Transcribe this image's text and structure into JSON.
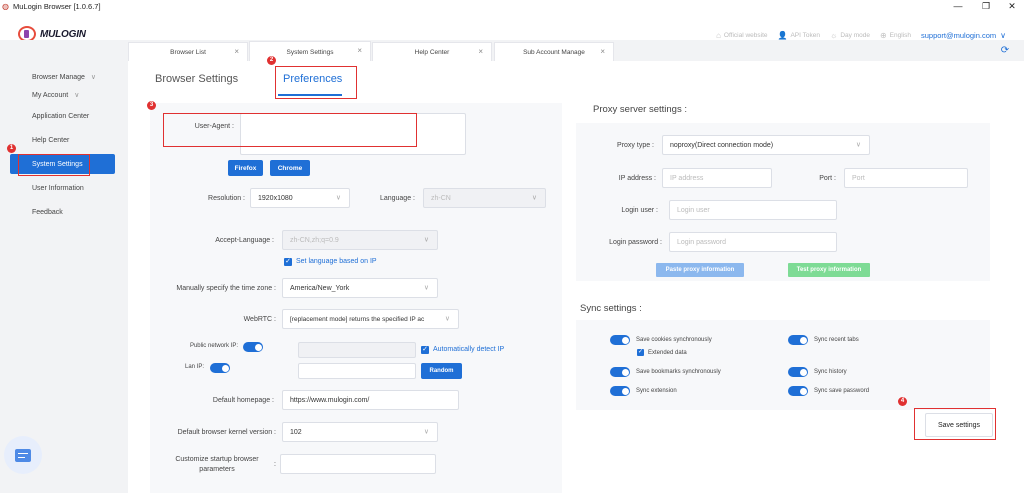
{
  "window": {
    "title": "MuLogin Browser  [1.0.6.7]",
    "minimize": "—",
    "restore": "❐",
    "close": "✕"
  },
  "header": {
    "logo_text": "MULOGIN",
    "links": [
      {
        "label": "Official website",
        "icon": "home-icon"
      },
      {
        "label": "API Token",
        "icon": "user-key-icon"
      },
      {
        "label": "Day mode",
        "icon": "sun-icon"
      },
      {
        "label": "English",
        "icon": "globe-icon"
      }
    ],
    "email": "support@mulogin.com"
  },
  "sidebar": {
    "items": [
      {
        "label": "Browser Manage",
        "has_chevron": true
      },
      {
        "label": "My Account",
        "has_chevron": true
      },
      {
        "label": "Application Center"
      },
      {
        "label": "Help Center"
      },
      {
        "label": "System Settings",
        "active": true
      },
      {
        "label": "User Information"
      },
      {
        "label": "Feedback"
      }
    ]
  },
  "tabs": [
    {
      "label": "Browser List"
    },
    {
      "label": "System Settings",
      "active": true
    },
    {
      "label": "Help Center"
    },
    {
      "label": "Sub Account Manage"
    }
  ],
  "content": {
    "subtabs": {
      "browser_settings": "Browser Settings",
      "preferences": "Preferences"
    },
    "browser": {
      "user_agent_label": "User-Agent :",
      "user_agent_value": "",
      "firefox_btn": "Firefox",
      "chrome_btn": "Chrome",
      "resolution_label": "Resolution :",
      "resolution_value": "1920x1080",
      "language_label": "Language :",
      "language_value": "zh-CN",
      "accept_language_label": "Accept-Language :",
      "accept_language_value": "zh-CN,zh;q=0.9",
      "set_language_label": "Set language based on IP",
      "timezone_label": "Manually specify the time zone :",
      "timezone_value": "America/New_York",
      "webrtc_label": "WebRTC :",
      "webrtc_value": "[replacement mode] returns the specified IP ac",
      "public_ip_label": "Public network IP:",
      "public_ip_value": "",
      "auto_detect_label": "Automatically detect IP",
      "lan_ip_label": "Lan IP:",
      "lan_ip_value": "",
      "random_btn": "Random",
      "homepage_label": "Default homepage :",
      "homepage_value": "https://www.mulogin.com/",
      "kernel_label": "Default browser kernel version :",
      "kernel_value": "102",
      "startup_label_1": "Customize startup browser",
      "startup_label_2": "parameters",
      "startup_colon": ":",
      "startup_value": ""
    },
    "proxy": {
      "title": "Proxy server settings :",
      "type_label": "Proxy type :",
      "type_value": "noproxy(Direct connection mode)",
      "ip_label": "IP address :",
      "ip_placeholder": "IP address",
      "port_label": "Port :",
      "port_placeholder": "Port",
      "user_label": "Login user :",
      "user_placeholder": "Login user",
      "password_label": "Login password :",
      "password_placeholder": "Login password",
      "paste_btn": "Paste proxy information",
      "test_btn": "Test proxy information"
    },
    "sync": {
      "title": "Sync settings :",
      "items": {
        "cookies": "Save cookies synchronously",
        "extended": "Extended data",
        "bookmarks": "Save bookmarks synchronously",
        "extension": "Sync extension",
        "recent_tabs": "Sync recent tabs",
        "history": "Sync history",
        "password": "Sync save password"
      }
    },
    "save_btn": "Save settings"
  },
  "annotations": [
    "1",
    "2",
    "3",
    "4"
  ],
  "colors": {
    "accent": "#1f6fd6",
    "annotation": "#e03131",
    "test_button": "#7edb95",
    "paste_button": "#8cb8ee"
  }
}
